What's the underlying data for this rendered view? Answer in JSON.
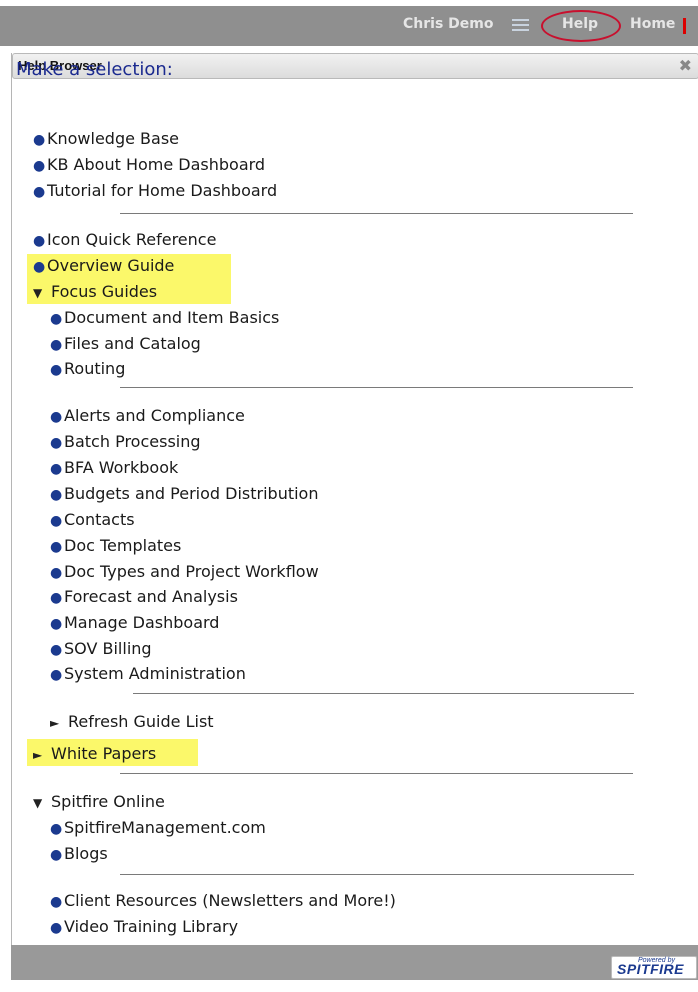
{
  "topbar": {
    "user": "Chris Demo",
    "help": "Help",
    "home": "Home"
  },
  "panel": {
    "title": "Help Browser",
    "close": "✖",
    "selection": "Make a selection:"
  },
  "items": {
    "kb": "Knowledge Base",
    "kb_about": "KB About Home Dashboard",
    "tutorial": "Tutorial for Home Dashboard",
    "icon_ref": "Icon Quick Reference",
    "overview": "Overview Guide",
    "focus": "Focus Guides",
    "doc_basics": "Document and Item Basics",
    "files": "Files and Catalog",
    "routing": "Routing",
    "alerts": "Alerts and Compliance",
    "batch": "Batch Processing",
    "bfa": "BFA Workbook",
    "budgets": "Budgets and Period Distribution",
    "contacts": "Contacts",
    "doc_templates": "Doc Templates",
    "doc_types": "Doc Types and Project Workflow",
    "forecast": "Forecast and Analysis",
    "manage": "Manage Dashboard",
    "sov": "SOV Billing",
    "sysadmin": "System Administration",
    "refresh": "Refresh Guide List",
    "white_papers": "White Papers",
    "spitfire_online": "Spitfire Online",
    "spitfire_mgmt": "SpitfireManagement.com",
    "blogs": "Blogs",
    "client_resources": "Client Resources (Newsletters and More!)",
    "video": "Video Training Library"
  },
  "footer": {
    "powered": "Powered by",
    "brand": "SPITFIRE"
  },
  "colors": {
    "highlight": "#fbf86a",
    "help_circle": "#c8102e",
    "link_blue": "#1b2a8f"
  }
}
